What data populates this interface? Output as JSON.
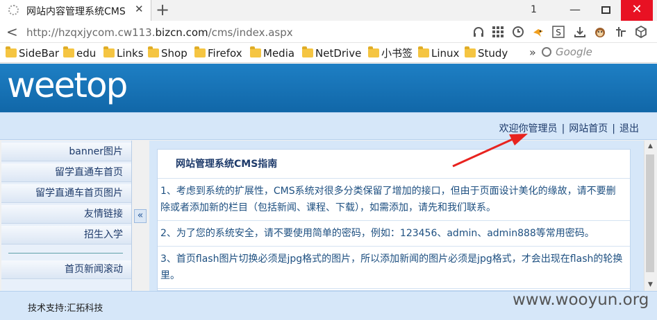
{
  "browser": {
    "tab_title": "网站内容管理系统CMS",
    "new_tab": "+",
    "tab_count": "1",
    "url_prefix": "http://hzqxjycom.cw113.",
    "url_domain": "bizcn.com",
    "url_path": "/cms/index.aspx",
    "window_minimize": "—",
    "window_close": "✕",
    "bookmarks": [
      "SideBar",
      "edu",
      "Links",
      "Shop",
      "Firefox",
      "Media",
      "NetDrive",
      "小书签",
      "Linux",
      "Study"
    ],
    "bookmarks_more": "»",
    "search_placeholder": "Google",
    "toolbar_icons": [
      "headphones-icon",
      "grid-icon",
      "history-icon",
      "bird-icon",
      "s-extension-icon",
      "download-icon",
      "monkey-icon",
      "sign-icon",
      "cube-icon"
    ]
  },
  "page": {
    "logo": "weetop",
    "header_links": {
      "welcome": "欢迎你管理员",
      "separator": "|",
      "home": "网站首页",
      "logout": "退出"
    },
    "sidebar_items": [
      "banner图片",
      "留学直通车首页",
      "留学直通车首页图片",
      "友情链接",
      "招生入学"
    ],
    "sidebar_items_after_divider": [
      "首页新闻滚动"
    ],
    "collapse_label": "«",
    "guide_title": "网站管理系统CMS指南",
    "guide_items": [
      "1、考虑到系统的扩展性，CMS系统对很多分类保留了增加的接口，但由于页面设计美化的缘故，请不要删除或者添加新的栏目（包括新闻、课程、下载），如需添加，请先和我们联系。",
      "2、为了您的系统安全，请不要使用简单的密码，例如：123456、admin、admin888等常用密码。",
      "3、首页flash图片切换必须是jpg格式的图片，所以添加新闻的图片必须是jpg格式，才会出现在flash的轮换里。"
    ],
    "footer": "技术支持:汇拓科技",
    "watermark": "www.wooyun.org"
  },
  "colors": {
    "header_blue": "#1167a8",
    "light_blue": "#d6e7f9",
    "close_red": "#e81123",
    "annotation_red": "#e8231f"
  }
}
